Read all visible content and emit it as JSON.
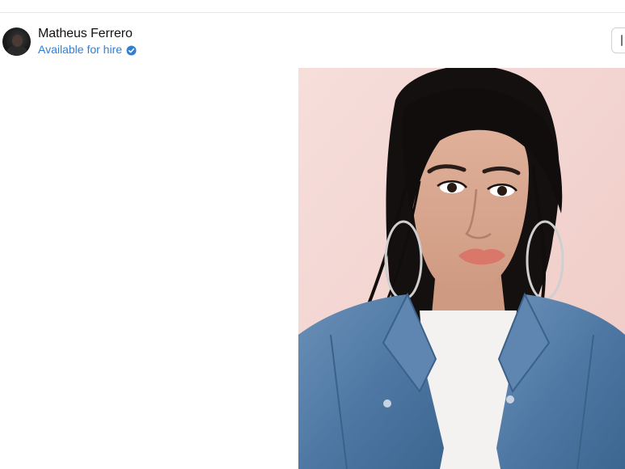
{
  "author": {
    "name": "Matheus Ferrero",
    "hire_label": "Available for hire",
    "avatar_icon": "avatar",
    "verified_icon": "verified-badge-icon"
  },
  "colors": {
    "link": "#2f7fd6",
    "photo_background": "#f3d8d4",
    "denim": "#4f79a4"
  },
  "photo": {
    "subject": "woman in denim jacket against pink wall"
  },
  "corner_button": {
    "icon": "bookmark-icon"
  }
}
